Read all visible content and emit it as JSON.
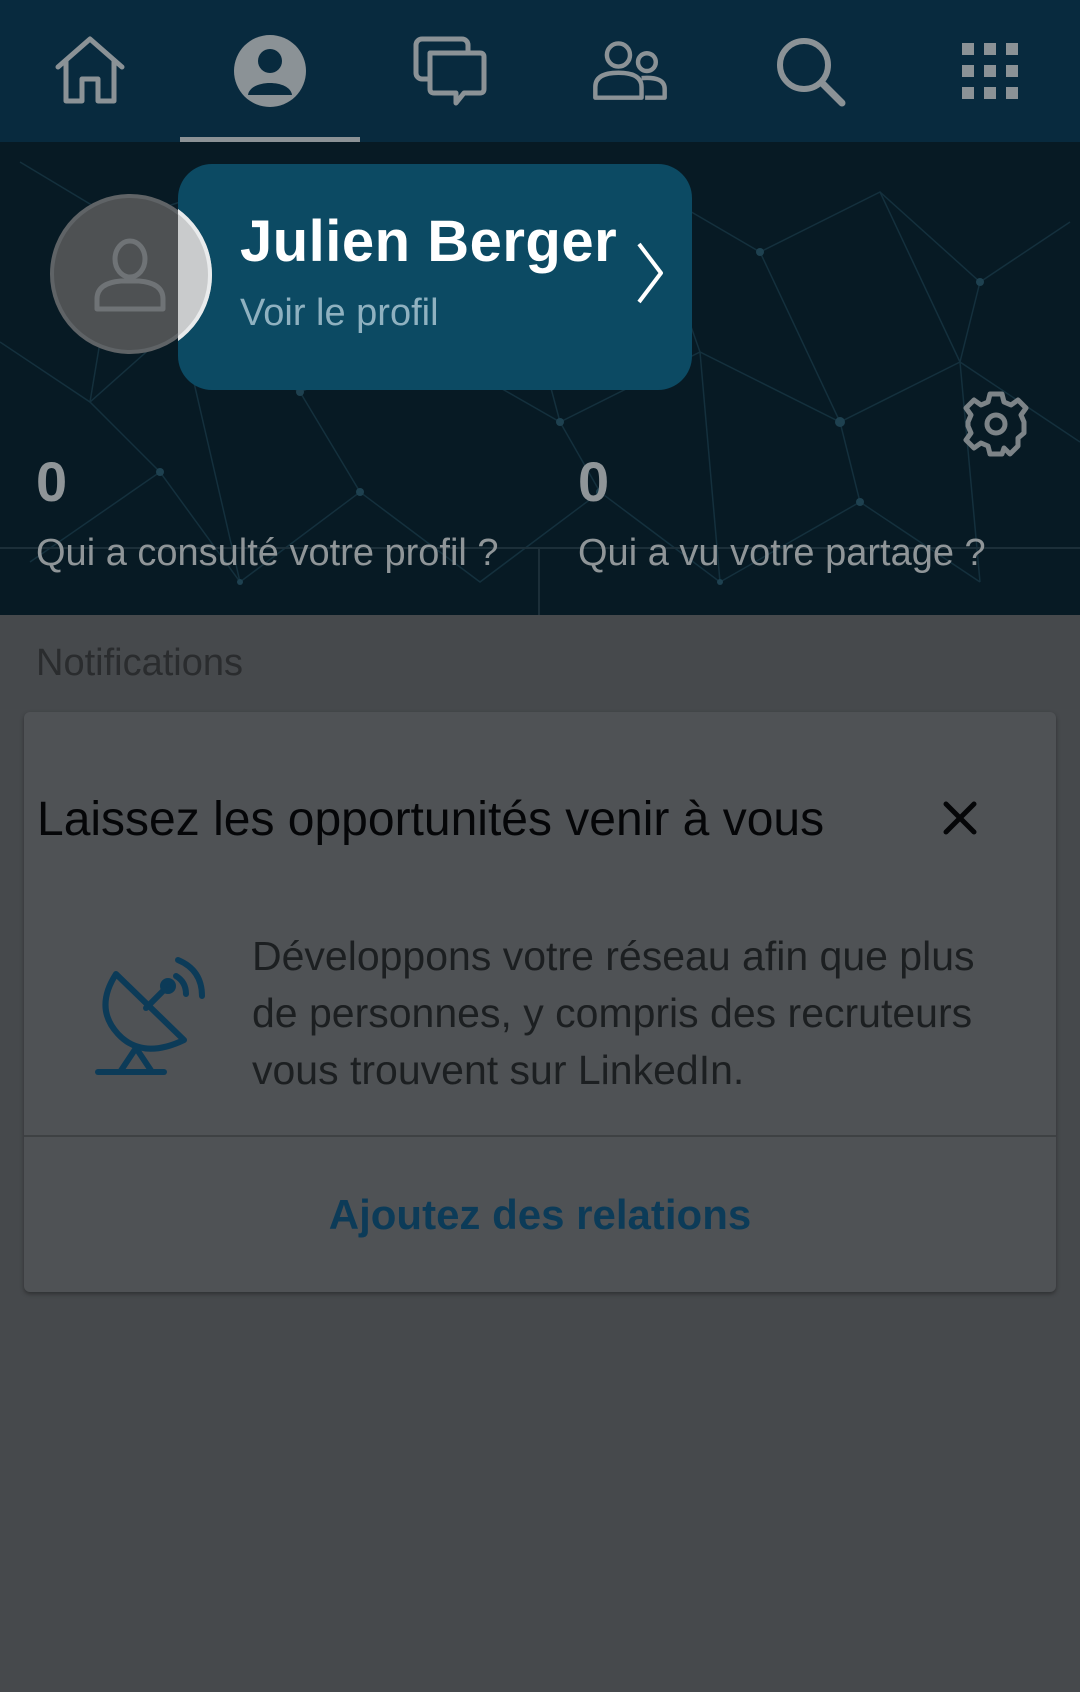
{
  "colors": {
    "topbar": "#082a3e",
    "hero": "#071a24",
    "profile_card": "#0c4a63",
    "overlay_bg": "#46494c",
    "card": "#4f5255",
    "action": "#0c3b58"
  },
  "nav": {
    "items": [
      {
        "icon": "home-icon"
      },
      {
        "icon": "profile-icon",
        "active": true
      },
      {
        "icon": "messages-icon"
      },
      {
        "icon": "network-icon"
      },
      {
        "icon": "search-icon"
      },
      {
        "icon": "apps-grid-icon"
      }
    ]
  },
  "profile": {
    "name": "Julien Berger",
    "view_profile": "Voir le profil"
  },
  "stats": {
    "left": {
      "count": "0",
      "label": "Qui a consulté votre profil ?"
    },
    "right": {
      "count": "0",
      "label": "Qui a vu votre partage ?"
    }
  },
  "notifications": {
    "section_title": "Notifications",
    "card": {
      "title": "Laissez les opportunités venir à vous",
      "body": "Développons votre réseau afin que plus de personnes, y compris des recruteurs vous trouvent sur LinkedIn.",
      "action": "Ajoutez des relations",
      "icon": "satellite-dish-icon"
    }
  }
}
